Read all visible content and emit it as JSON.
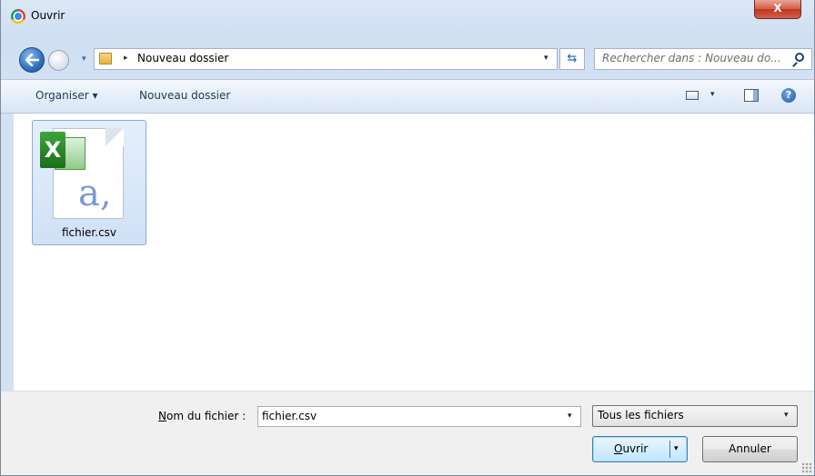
{
  "window": {
    "title": "Ouvrir",
    "close_glyph": "X"
  },
  "nav": {
    "breadcrumb": "Nouveau dossier",
    "crumb_sep": "▸",
    "dropdown_glyph": "▾",
    "history_glyph": "▾",
    "refresh_glyph": "⇆",
    "search_placeholder": "Rechercher dans : Nouveau do..."
  },
  "toolbar": {
    "organize_label": "Organiser ▾",
    "new_folder_label": "Nouveau dossier",
    "view_drop_glyph": "▾",
    "help_glyph": "?"
  },
  "files": [
    {
      "name": "fichier.csv",
      "icon": "excel-csv-file-icon",
      "preview_letter": "a,"
    }
  ],
  "footer": {
    "filename_label_accel": "N",
    "filename_label_rest": "om du fichier :",
    "filename_value": "fichier.csv",
    "filter_value": "Tous les fichiers",
    "open_label_accel": "O",
    "open_label_rest": "uvrir",
    "cancel_label": "Annuler",
    "drop_glyph": "▾"
  },
  "colors": {
    "chrome_blue": "#d3e1f3",
    "selection": "#cfe1f7",
    "close_red": "#c1351d",
    "primary_button": "#bee6fd"
  }
}
